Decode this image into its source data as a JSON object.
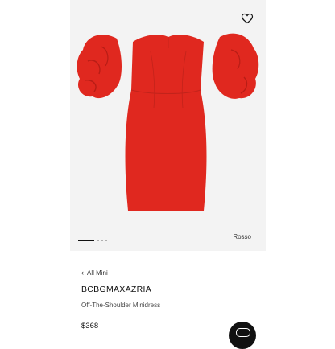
{
  "gallery": {
    "color_name": "Rosso",
    "slide_count": 3,
    "active_slide": 1
  },
  "breadcrumb": {
    "label": "All Mini"
  },
  "product": {
    "brand": "BCBGMAXAZRIA",
    "name": "Off-The-Shoulder Minidress",
    "price": "$368"
  },
  "colors": {
    "dress": "#e0281f",
    "image_bg": "#f3f3f3",
    "accent": "#111111"
  },
  "icons": {
    "wishlist": "heart-icon",
    "back": "chevron-left-icon",
    "chat": "chat-icon"
  }
}
